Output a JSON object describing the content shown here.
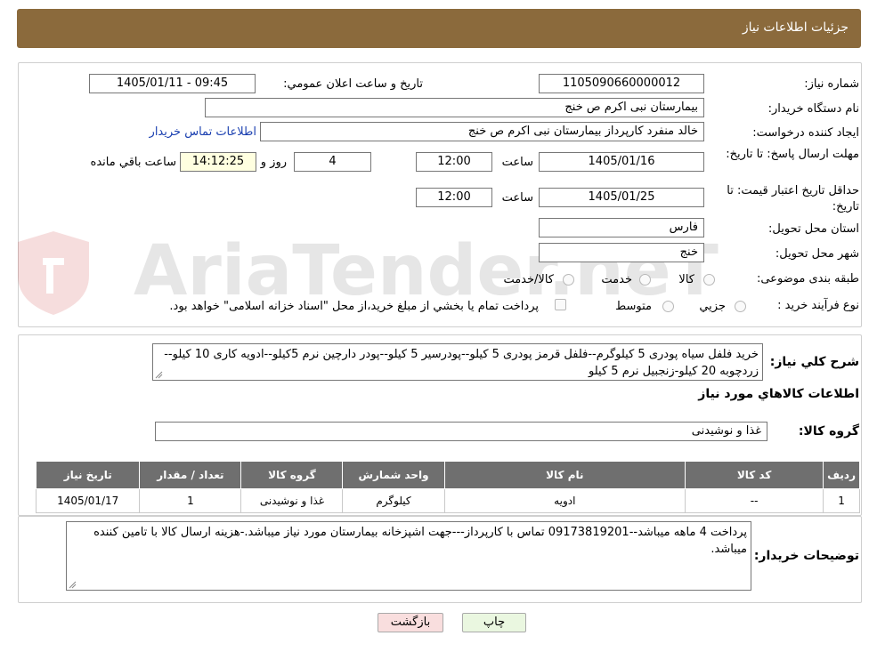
{
  "header": {
    "title": "جزئیات اطلاعات نیاز"
  },
  "watermark": {
    "text": "AriaTender.neT"
  },
  "form": {
    "need_number_label": "شماره نیاز:",
    "need_number": "1105090660000012",
    "announce_label": "تاریخ و ساعت اعلان عمومي:",
    "announce_value": "1405/01/11 - 09:45",
    "buyer_org_label": "نام دستگاه خريدار:",
    "buyer_org": "بیمارستان نبی اکرم  ص  خنج",
    "requester_label": "ايجاد کننده درخواست:",
    "requester": "خالد منفرد کارپرداز بیمارستان نبی اکرم  ص  خنج",
    "contact_link": "اطلاعات تماس خريدار",
    "deadline_label": "مهلت ارسال پاسخ: تا تاريخ:",
    "deadline_date": "1405/01/16",
    "time_label": "ساعت",
    "deadline_time": "12:00",
    "days_value": "4",
    "days_label": "روز و",
    "remaining_time": "14:12:25",
    "remaining_label": "ساعت باقي مانده",
    "validity_label": "حداقل تاريخ اعتبار قيمت: تا تاريخ:",
    "validity_date": "1405/01/25",
    "validity_time": "12:00",
    "province_label": "استان محل تحويل:",
    "province": "فارس",
    "city_label": "شهر محل تحويل:",
    "city": "خنج",
    "category_label": "طبقه بندی موضوعی:",
    "category_options": [
      "کالا",
      "خدمت",
      "کالا/خدمت"
    ],
    "process_label": "نوع فرآيند خريد :",
    "process_options": [
      "جزيي",
      "متوسط"
    ],
    "payment_note": "پرداخت تمام يا بخشي از مبلغ خريد،از محل \"اسناد خزانه اسلامی\" خواهد بود."
  },
  "description": {
    "label": "شرح کلي نياز:",
    "text": "خرید فلفل سیاه پودری 5 کیلوگرم--فلفل قرمز پودری 5 کیلو--پودرسیر 5 کیلو--پودر دارچین نرم 5کیلو--ادویه کاری 10 کیلو--زردچوبه 20 کیلو-زنجبیل نرم 5 کیلو"
  },
  "items_section": {
    "title": "اطلاعات کالاهاي مورد نياز",
    "group_label": "گروه کالا:",
    "group_value": "غذا و نوشیدنی",
    "columns": [
      "رديف",
      "کد کالا",
      "نام کالا",
      "واحد شمارش",
      "گروه کالا",
      "تعداد / مقدار",
      "تاريخ نياز"
    ],
    "rows": [
      [
        "1",
        "--",
        "ادویه",
        "کیلوگرم",
        "غذا و نوشیدنی",
        "1",
        "1405/01/17"
      ]
    ]
  },
  "buyer_notes": {
    "label": "توضيحات خريدار:",
    "text": "پرداخت 4 ماهه میباشد--09173819201 تماس با کارپرداز---جهت اشپزخانه بیمارستان مورد نیاز میباشد.-هزینه ارسال کالا با تامین کننده میباشد."
  },
  "buttons": {
    "print": "چاپ",
    "back": "بازگشت"
  },
  "colors": {
    "header": "#8b6a3c",
    "table_header": "#6f6f6f",
    "print_button": "#eaf7e0",
    "back_button": "#f9dede"
  }
}
